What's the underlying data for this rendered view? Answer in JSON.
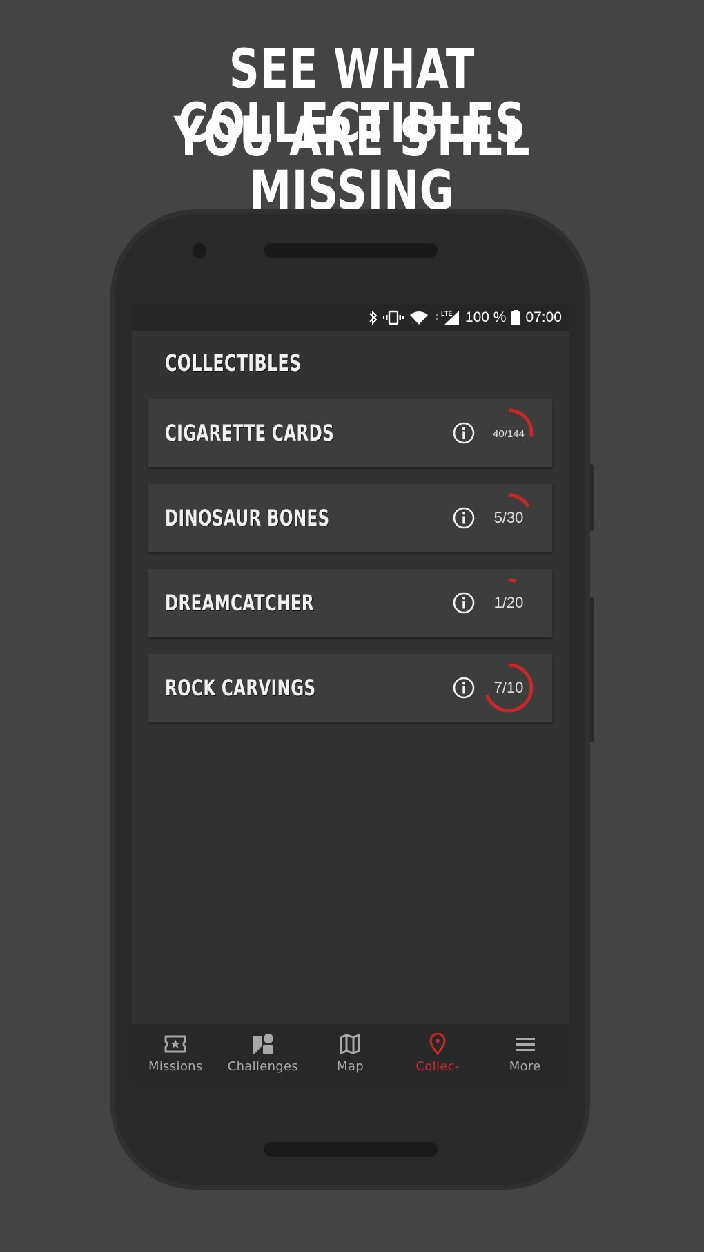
{
  "headline": {
    "line1": "SEE WHAT COLLECTIBLES",
    "line2": "YOU ARE STILL MISSING"
  },
  "status_bar": {
    "icons": [
      "bluetooth-icon",
      "vibrate-icon",
      "wifi-icon",
      "lte-signal-icon",
      "battery-icon"
    ],
    "network_label": "LTE",
    "battery": "100 %",
    "time": "07:00"
  },
  "screen": {
    "title": "COLLECTIBLES",
    "accent_color": "#c62828",
    "collectibles": [
      {
        "name": "CIGARETTE CARDS",
        "collected": 40,
        "total": 144,
        "count_label": "40/144"
      },
      {
        "name": "DINOSAUR BONES",
        "collected": 5,
        "total": 30,
        "count_label": "5/30"
      },
      {
        "name": "DREAMCATCHER",
        "collected": 1,
        "total": 20,
        "count_label": "1/20"
      },
      {
        "name": "ROCK CARVINGS",
        "collected": 7,
        "total": 10,
        "count_label": "7/10"
      }
    ]
  },
  "bottom_nav": {
    "items": [
      {
        "label": "Missions",
        "icon": "ticket-star-icon",
        "active": false
      },
      {
        "label": "Challenges",
        "icon": "shapes-icon",
        "active": false
      },
      {
        "label": "Map",
        "icon": "map-icon",
        "active": false
      },
      {
        "label": "Collec-",
        "icon": "location-pin-icon",
        "active": true
      },
      {
        "label": "More",
        "icon": "menu-icon",
        "active": false
      }
    ]
  }
}
